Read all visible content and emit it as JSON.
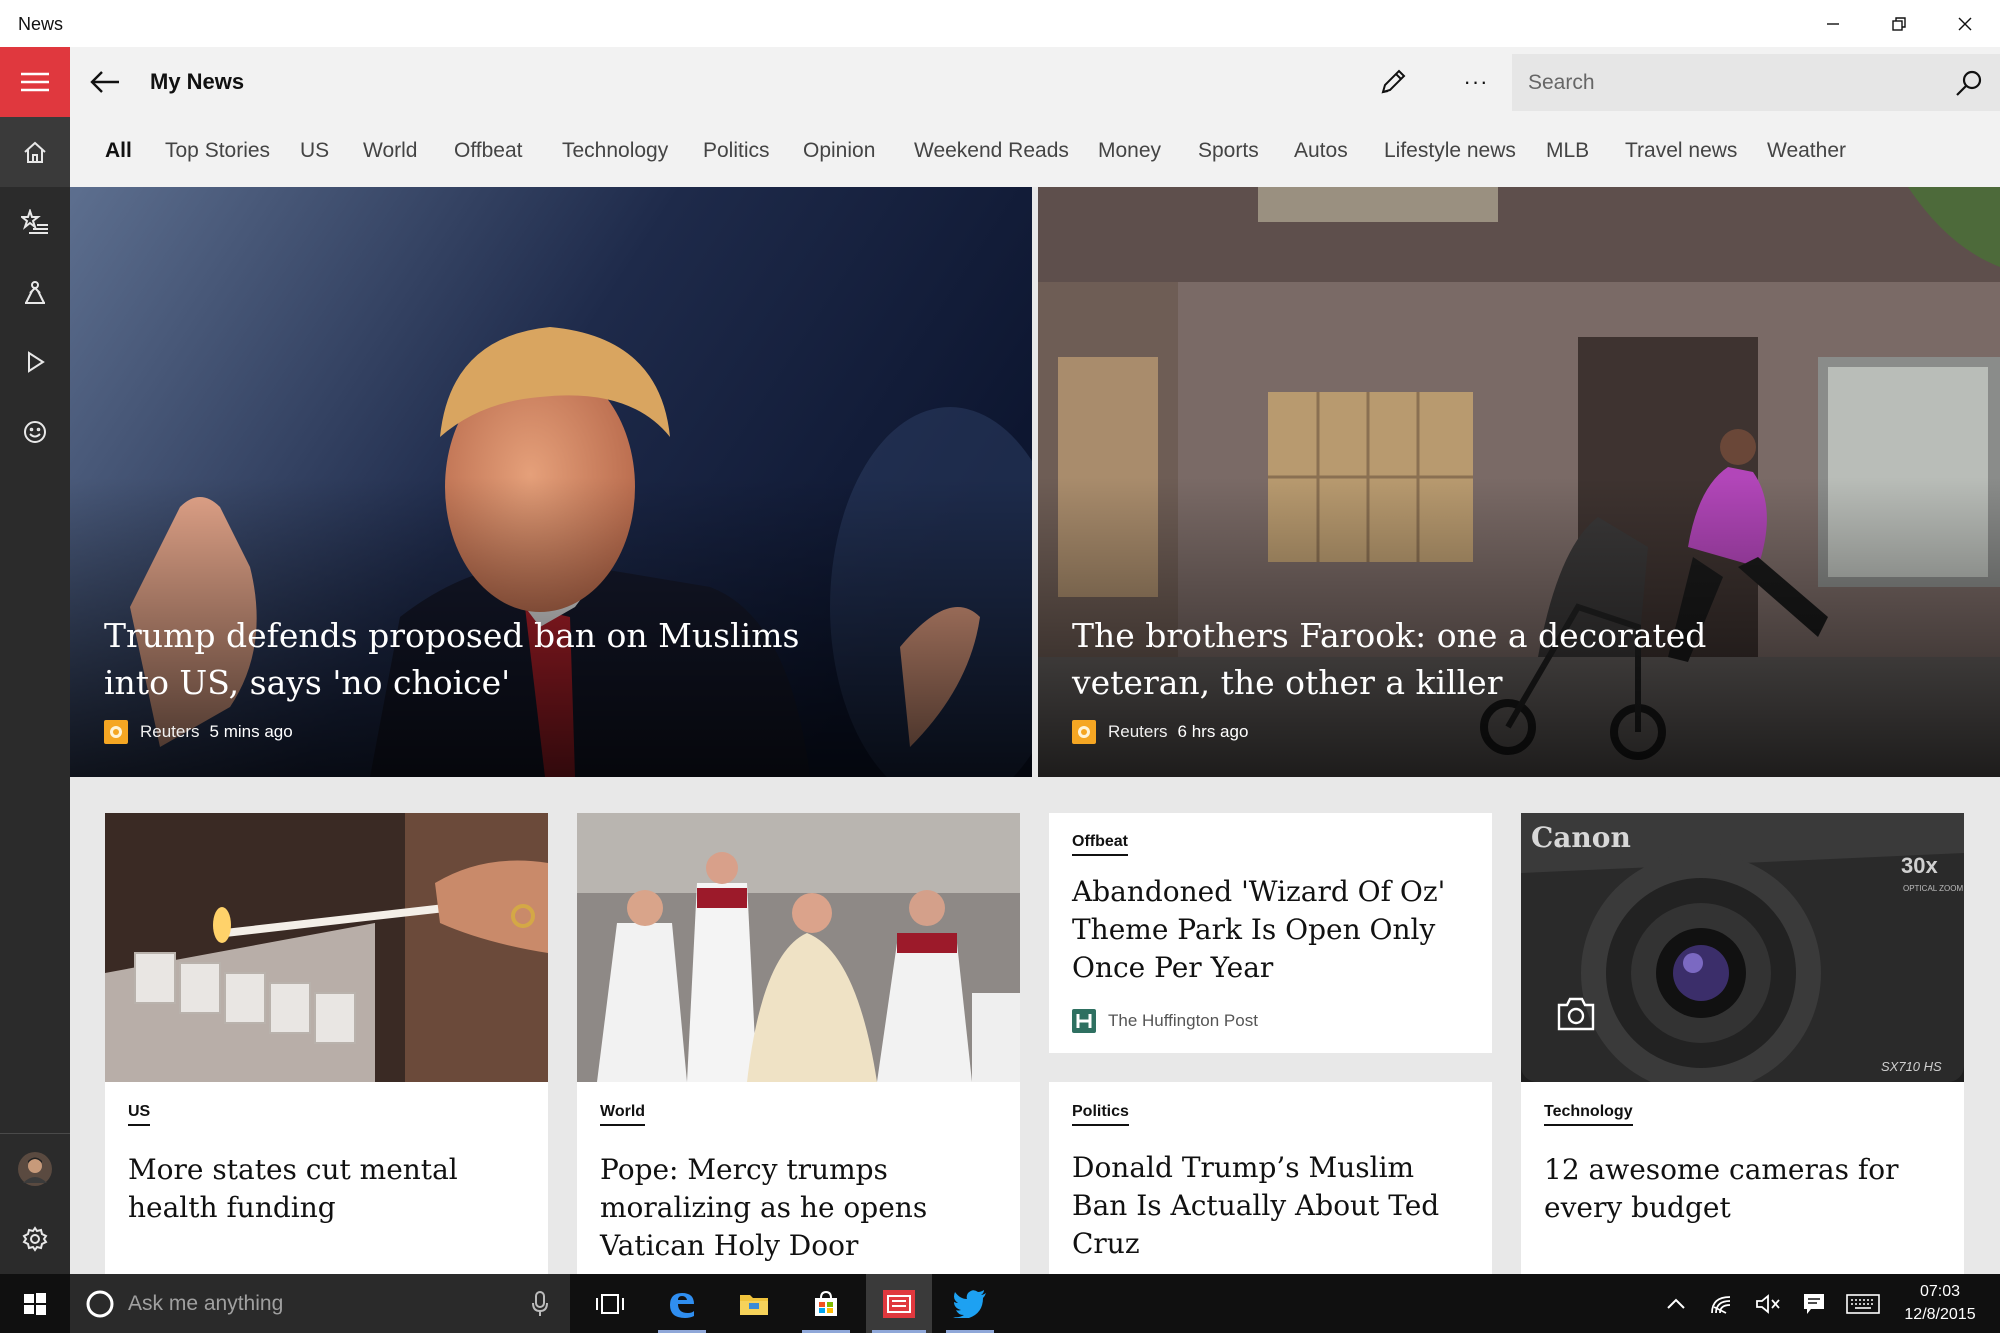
{
  "app": {
    "title": "News"
  },
  "header": {
    "page_title": "My News",
    "more_label": "···",
    "search_placeholder": "Search"
  },
  "rail": {
    "items": [
      "menu-icon",
      "home-icon",
      "favorites-icon",
      "local-icon",
      "video-icon",
      "feedback-icon",
      "avatar",
      "gear-icon"
    ],
    "accent": "#e0383e"
  },
  "tabs": [
    {
      "label": "All",
      "active": true
    },
    {
      "label": "Top Stories"
    },
    {
      "label": "US"
    },
    {
      "label": "World"
    },
    {
      "label": "Offbeat"
    },
    {
      "label": "Technology"
    },
    {
      "label": "Politics"
    },
    {
      "label": "Opinion"
    },
    {
      "label": "Weekend Reads"
    },
    {
      "label": "Money"
    },
    {
      "label": "Sports"
    },
    {
      "label": "Autos"
    },
    {
      "label": "Lifestyle news"
    },
    {
      "label": "MLB"
    },
    {
      "label": "Travel news"
    },
    {
      "label": "Weather"
    }
  ],
  "hero": [
    {
      "title": "Trump defends proposed ban on Muslims into US, says 'no choice'",
      "source": "Reuters",
      "time": "5 mins ago"
    },
    {
      "title": "The brothers Farook: one a decorated veteran, the other a killer",
      "source": "Reuters",
      "time": "6 hrs ago"
    }
  ],
  "cards": [
    {
      "category": "US",
      "title": "More states cut mental health funding"
    },
    {
      "category": "World",
      "title": "Pope: Mercy trumps moralizing as he opens Vatican Holy Door"
    },
    {
      "category": "Offbeat",
      "title": "Abandoned 'Wizard Of Oz' Theme Park Is Open Only Once Per Year",
      "source": "The Huffington Post"
    },
    {
      "category": "Politics",
      "title": "Donald Trump’s Muslim Ban Is Actually About Ted Cruz"
    },
    {
      "category": "Technology",
      "title": "12 awesome cameras for every budget",
      "image_text": {
        "brand": "Canon",
        "zoom": "30x",
        "zoom_sub": "OPTICAL ZOOM",
        "model": "SX710 HS"
      }
    }
  ],
  "taskbar": {
    "search_placeholder": "Ask me anything",
    "time": "07:03",
    "date": "12/8/2015"
  },
  "colors": {
    "accent": "#e0383e",
    "rail": "#2b2b2b",
    "header": "#f2f2f2",
    "content_bg": "#e8e8e8",
    "taskbar": "#101010"
  }
}
